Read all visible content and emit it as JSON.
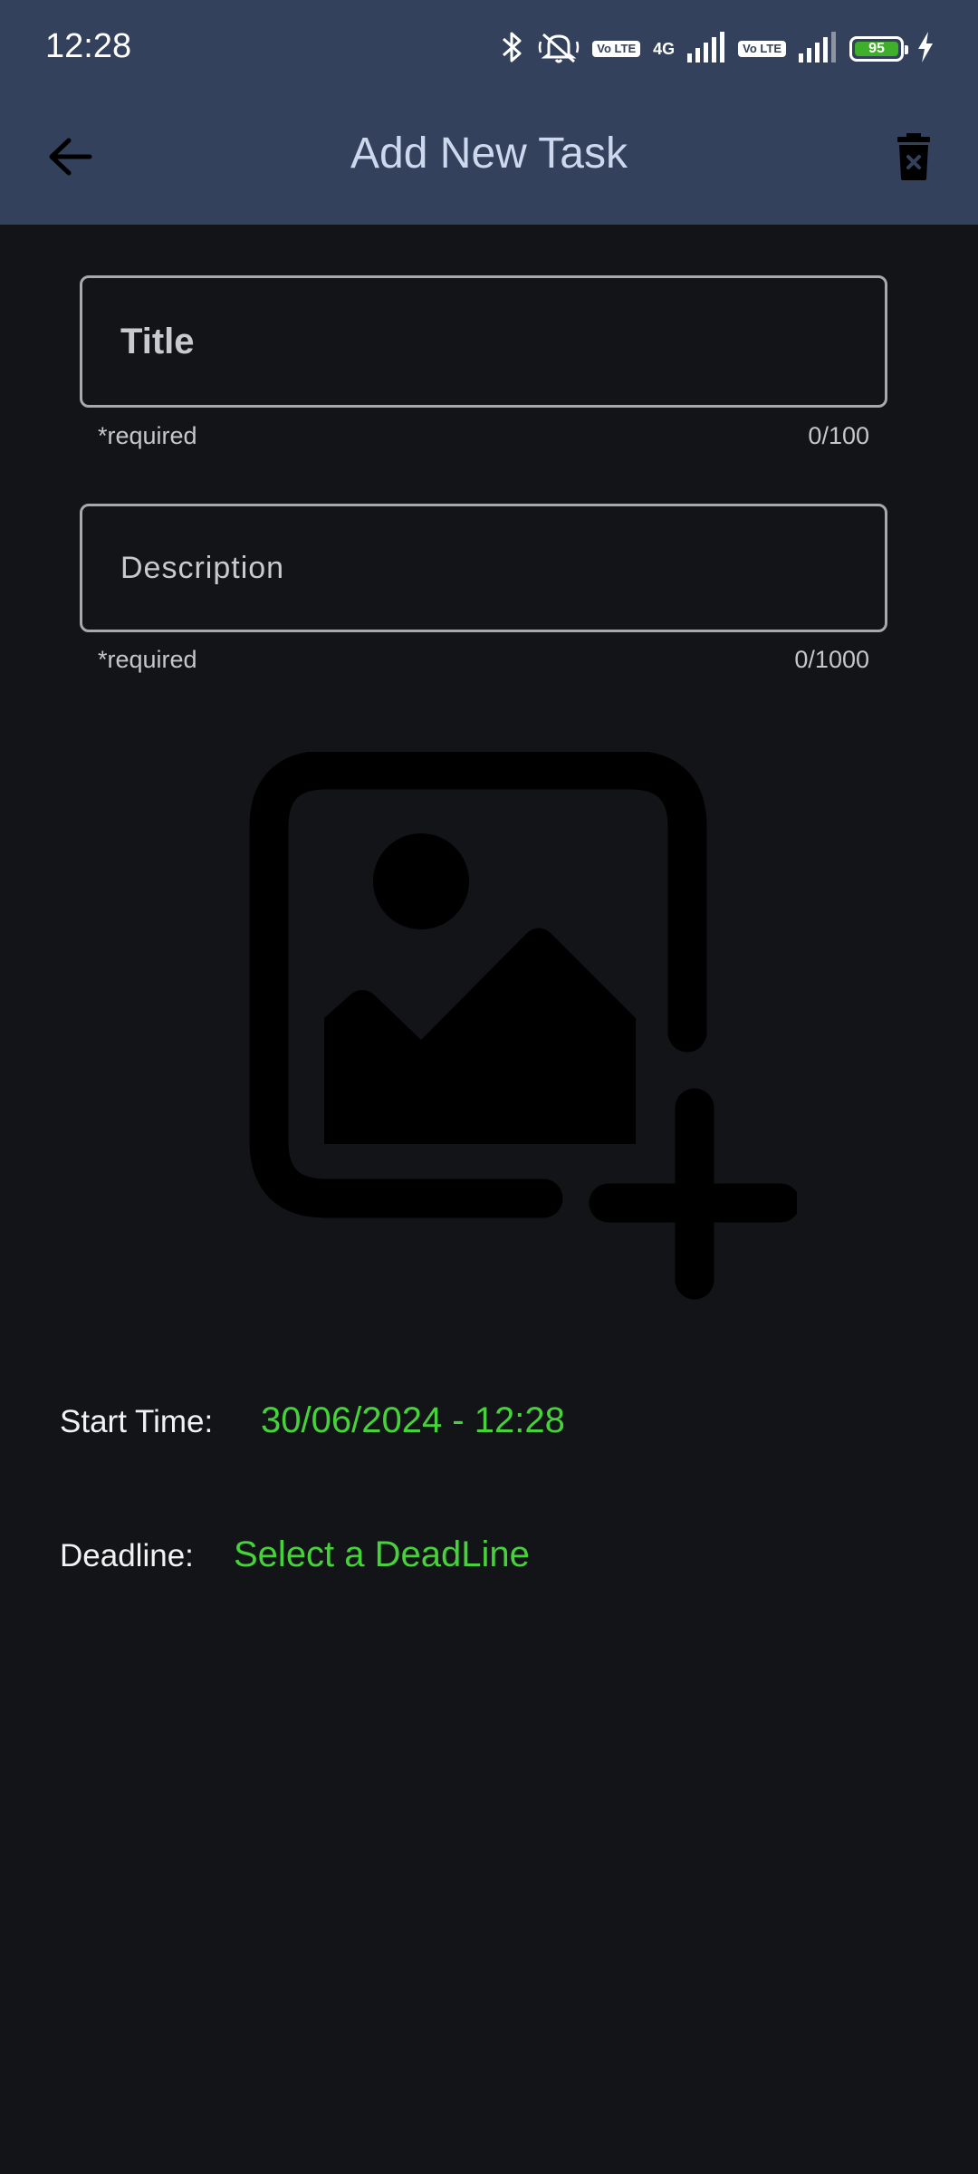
{
  "status_bar": {
    "time": "12:28",
    "volte1": "Vo LTE",
    "network": "4G",
    "volte2": "Vo LTE",
    "battery": "95"
  },
  "app_bar": {
    "title": "Add New Task"
  },
  "form": {
    "title_field": {
      "placeholder": "Title",
      "value": "",
      "helper": "*required",
      "counter": "0/100"
    },
    "description_field": {
      "placeholder": "Description",
      "value": "",
      "helper": "*required",
      "counter": "0/1000"
    }
  },
  "schedule": {
    "start_label": "Start Time:",
    "start_value": "30/06/2024 - 12:28",
    "deadline_label": "Deadline:",
    "deadline_value": "Select a DeadLine"
  },
  "colors": {
    "app_bar": "#33415c",
    "background": "#131418",
    "accent_green": "#45d339"
  },
  "icons": [
    "bluetooth-icon",
    "mute-icon",
    "signal-icon",
    "battery-icon",
    "charging-icon",
    "back-arrow-icon",
    "delete-icon",
    "add-image-icon"
  ]
}
